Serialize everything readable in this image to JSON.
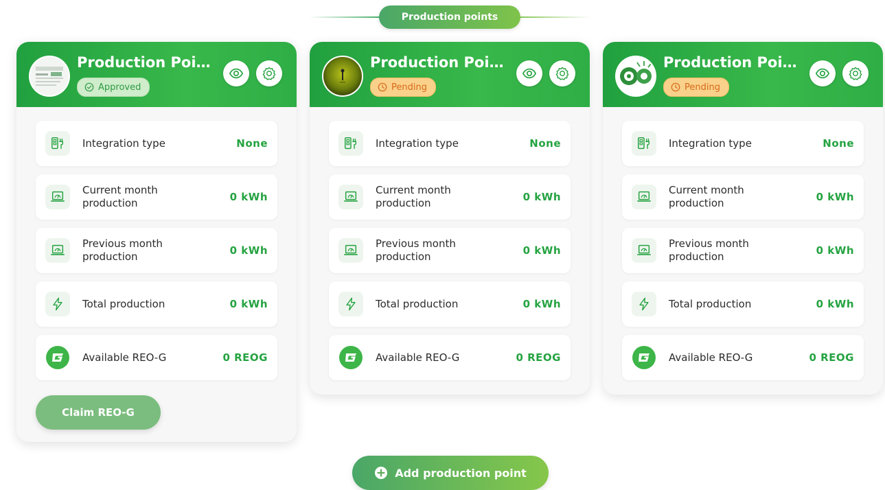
{
  "header": {
    "title": "Production points"
  },
  "colors": {
    "accent_green": "#25a341",
    "pending_orange": "#d86a1c",
    "approved_bg": "#cfeccb",
    "pending_bg": "#f9d18a"
  },
  "icons": {
    "view": "eye-icon",
    "settings": "gear-icon",
    "integration": "device-plug-icon",
    "production": "laptop-gauge-icon",
    "total": "lightning-icon",
    "reo": "reo-g-coin-icon",
    "approved": "check-circle-icon",
    "pending": "clock-icon",
    "add": "plus-circle-icon"
  },
  "cards": [
    {
      "title": "Production Point...",
      "status": "Approved",
      "rows": [
        {
          "label": "Integration type",
          "value": "None"
        },
        {
          "label": "Current month production",
          "value": "0 kWh"
        },
        {
          "label": "Previous month production",
          "value": "0 kWh"
        },
        {
          "label": "Total production",
          "value": "0 kWh"
        },
        {
          "label": "Available REO-G",
          "value": "0 REOG"
        }
      ],
      "claim_label": "Claim REO-G"
    },
    {
      "title": "Production Point...",
      "status": "Pending",
      "rows": [
        {
          "label": "Integration type",
          "value": "None"
        },
        {
          "label": "Current month production",
          "value": "0 kWh"
        },
        {
          "label": "Previous month production",
          "value": "0 kWh"
        },
        {
          "label": "Total production",
          "value": "0 kWh"
        },
        {
          "label": "Available REO-G",
          "value": "0 REOG"
        }
      ]
    },
    {
      "title": "Production Point...",
      "status": "Pending",
      "rows": [
        {
          "label": "Integration type",
          "value": "None"
        },
        {
          "label": "Current month production",
          "value": "0 kWh"
        },
        {
          "label": "Previous month production",
          "value": "0 kWh"
        },
        {
          "label": "Total production",
          "value": "0 kWh"
        },
        {
          "label": "Available REO-G",
          "value": "0 REOG"
        }
      ]
    }
  ],
  "add_button": {
    "label": "Add production point"
  }
}
